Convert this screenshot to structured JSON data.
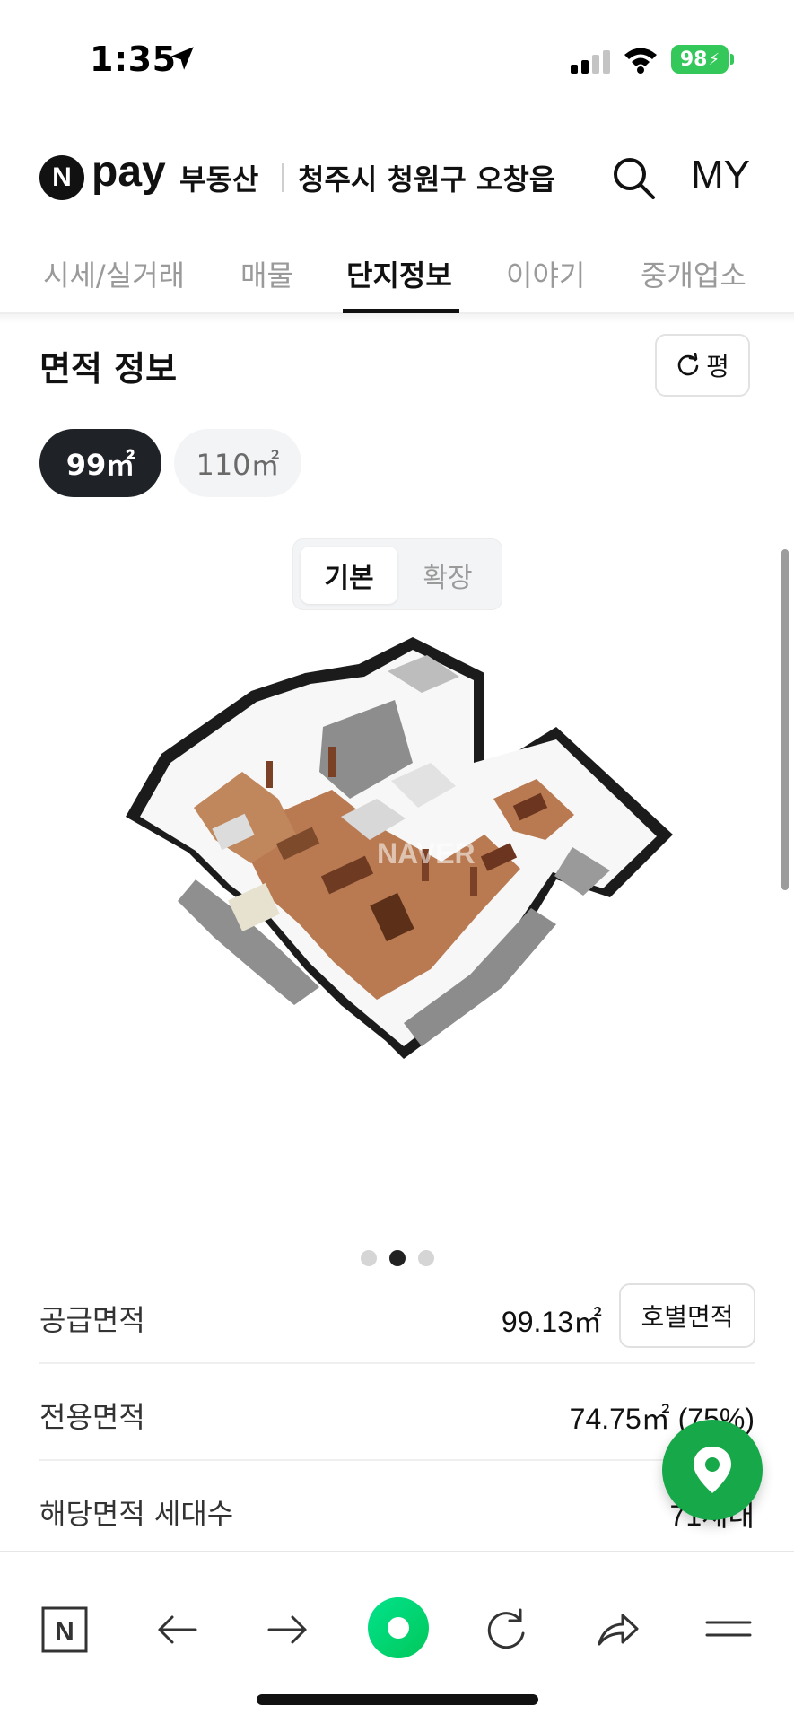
{
  "status_bar": {
    "time": "1:35",
    "battery": "98"
  },
  "header": {
    "logo_letter": "N",
    "brand": "pay",
    "service": "부동산",
    "location": "청주시 청원구 오창읍",
    "my_label": "MY"
  },
  "tabs": [
    {
      "label": "시세/실거래",
      "active": false
    },
    {
      "label": "매물",
      "active": false
    },
    {
      "label": "단지정보",
      "active": true
    },
    {
      "label": "이야기",
      "active": false
    },
    {
      "label": "중개업소",
      "active": false
    }
  ],
  "section": {
    "title": "면적 정보",
    "unit_toggle_label": "평",
    "area_chips": [
      {
        "label": "99㎡",
        "active": true
      },
      {
        "label": "110㎡",
        "active": false
      }
    ],
    "view_options": [
      {
        "label": "기본",
        "active": true
      },
      {
        "label": "확장",
        "active": false
      }
    ],
    "floorplan_watermark": "NAVER",
    "carousel": {
      "count": 3,
      "active_index": 1
    }
  },
  "info": {
    "supply_area": {
      "label": "공급면적",
      "value": "99.13㎡",
      "button": "호별면적"
    },
    "exclusive_area": {
      "label": "전용면적",
      "value": "74.75㎡ (75%)"
    },
    "households": {
      "label": "해당면적 세대수",
      "value": "71세대"
    }
  },
  "colors": {
    "naver_green": "#03c75a",
    "fab_green": "#17a84a",
    "chip_active": "#1f2328",
    "battery": "#34c759"
  },
  "browser_bar": {
    "logo_letter": "N",
    "icons": [
      "naver-home-icon",
      "back-arrow-icon",
      "forward-arrow-icon",
      "green-dot-icon",
      "reload-icon",
      "share-icon",
      "menu-icon"
    ]
  }
}
